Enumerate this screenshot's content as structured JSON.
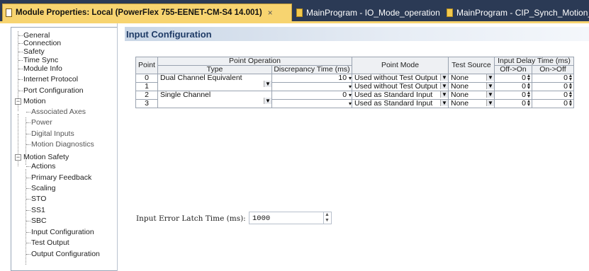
{
  "tabs": [
    {
      "label": "Module Properties: Local (PowerFlex 755-EENET-CM-S4 14.001)",
      "close": "×",
      "active": true
    },
    {
      "label": "MainProgram - IO_Mode_operation",
      "active": false
    },
    {
      "label": "MainProgram - CIP_Synch_Motion_op",
      "active": false
    }
  ],
  "tree": {
    "items": [
      {
        "label": "General"
      },
      {
        "label": "Connection"
      },
      {
        "label": "Safety"
      },
      {
        "label": "Time Sync"
      },
      {
        "label": "Module Info"
      },
      {
        "label": "Internet Protocol"
      },
      {
        "label": "Port Configuration"
      },
      {
        "label": "Motion",
        "expander": "−"
      },
      {
        "label": "Associated Axes"
      },
      {
        "label": "Power"
      },
      {
        "label": "Digital Inputs"
      },
      {
        "label": "Motion Diagnostics"
      },
      {
        "label": "Motion Safety",
        "expander": "−"
      },
      {
        "label": "Actions"
      },
      {
        "label": "Primary Feedback"
      },
      {
        "label": "Scaling"
      },
      {
        "label": "STO"
      },
      {
        "label": "SS1"
      },
      {
        "label": "SBC"
      },
      {
        "label": "Input Configuration"
      },
      {
        "label": "Test Output"
      },
      {
        "label": "Output Configuration"
      }
    ]
  },
  "main": {
    "title": "Input Configuration",
    "table": {
      "headers": {
        "point": "Point",
        "point_operation": "Point Operation",
        "type": "Type",
        "discrepancy": "Discrepancy Time (ms)",
        "point_mode": "Point Mode",
        "test_source": "Test Source",
        "input_delay": "Input Delay Time (ms)",
        "off_on": "Off->On",
        "on_off": "On->Off"
      },
      "rows": [
        {
          "point": "0",
          "type": "Dual Channel Equivalent",
          "discrepancy": "10",
          "mode": "Used without Test Output",
          "test_source": "None",
          "off_on": "0",
          "on_off": "0"
        },
        {
          "point": "1",
          "type": "",
          "discrepancy": "",
          "mode": "Used without Test Output",
          "test_source": "None",
          "off_on": "0",
          "on_off": "0"
        },
        {
          "point": "2",
          "type": "Single Channel",
          "discrepancy": "0",
          "mode": "Used as Standard Input",
          "test_source": "None",
          "off_on": "0",
          "on_off": "0"
        },
        {
          "point": "3",
          "type": "",
          "discrepancy": "",
          "mode": "Used as Standard Input",
          "test_source": "None",
          "off_on": "0",
          "on_off": "0"
        }
      ]
    },
    "latch": {
      "label": "Input Error Latch Time (ms):",
      "value": "1000"
    }
  }
}
